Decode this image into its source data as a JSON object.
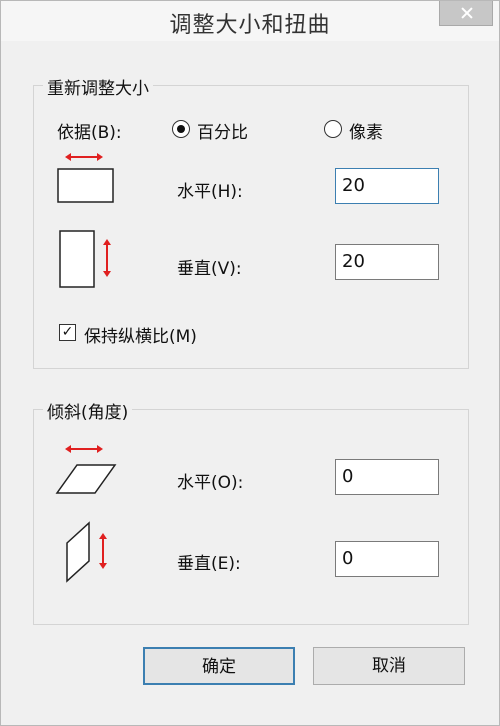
{
  "window": {
    "title": "调整大小和扭曲"
  },
  "resize": {
    "group_label": "重新调整大小",
    "by_label": "依据(B):",
    "option_percent": "百分比",
    "option_pixels": "像素",
    "horizontal_label": "水平(H):",
    "horizontal_value": "20",
    "vertical_label": "垂直(V):",
    "vertical_value": "20",
    "keep_ratio_label": "保持纵横比(M)"
  },
  "skew": {
    "group_label": "倾斜(角度)",
    "horizontal_label": "水平(O):",
    "horizontal_value": "0",
    "vertical_label": "垂直(E):",
    "vertical_value": "0"
  },
  "buttons": {
    "ok": "确定",
    "cancel": "取消"
  },
  "icons": {
    "close": "close-icon",
    "resize_h": "resize-horizontal-icon",
    "resize_v": "resize-vertical-icon",
    "skew_h": "skew-horizontal-icon",
    "skew_v": "skew-vertical-icon"
  },
  "colors": {
    "arrow": "#e02020",
    "focus_border": "#3c7fb1"
  }
}
